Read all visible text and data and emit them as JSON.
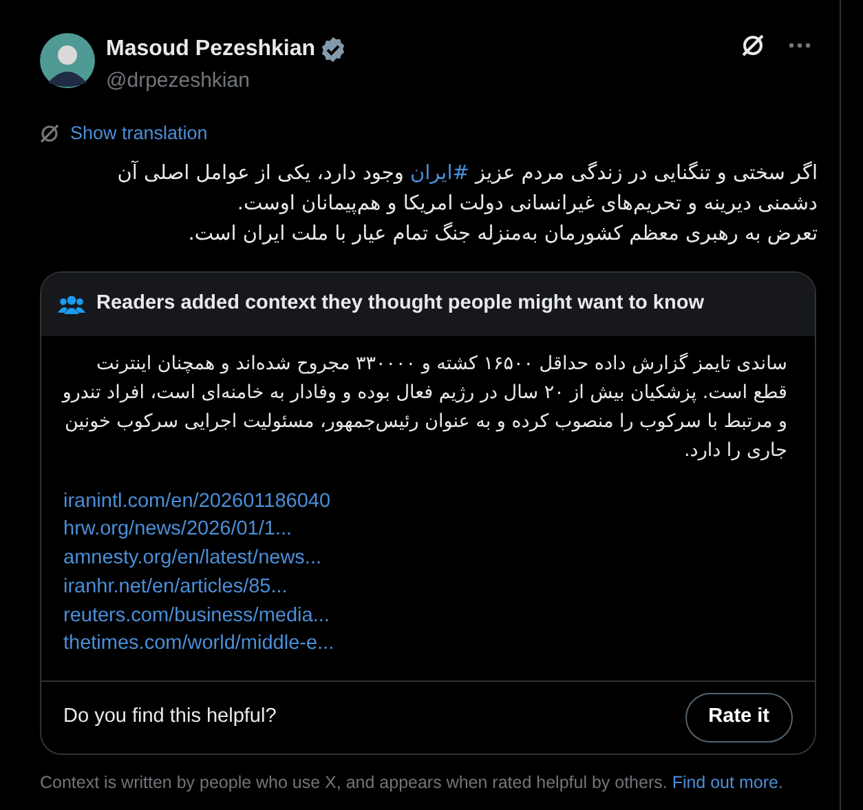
{
  "author": {
    "name": "Masoud Pezeshkian",
    "handle": "@drpezeshkian",
    "verified": true
  },
  "translate_link": "Show translation",
  "tweet": {
    "paragraphs": [
      [
        {
          "kind": "plain",
          "text": "اگر سختی و تنگنایی در زندگی مردم عزیز "
        },
        {
          "kind": "hashtag",
          "text": "#ایران"
        },
        {
          "kind": "plain",
          "text": " وجود دارد، یکی از عوامل اصلی آن دشمنی دیرینه و تحریم‌های غیرانسانی دولت امریکا و هم‌پیمانان اوست."
        }
      ],
      [
        {
          "kind": "plain",
          "text": "تعرض به رهبری معظم کشورمان به‌منزله جنگ تمام عیار با ملت ایران است."
        }
      ]
    ]
  },
  "community_note": {
    "header": "Readers added context they thought people might want to know",
    "body": "ساندی تایمز گزارش داده حداقل ۱۶۵۰۰ کشته و ۳۳۰۰۰۰ مجروح شده‌اند و همچنان اینترنت قطع است. پزشکیان بیش از ۲۰ سال در رژیم فعال بوده و وفادار به خامنه‌ای است، افراد تندرو و مرتبط با سرکوب را منصوب کرده و به عنوان رئیس‌جمهور، مسئولیت اجرایی سرکوب خونین جاری را دارد.",
    "links": [
      "iranintl.com/en/202601186040",
      "hrw.org/news/2026/01/1...",
      "amnesty.org/en/latest/news...",
      "iranhr.net/en/articles/85...",
      "reuters.com/business/media...",
      "thetimes.com/world/middle-e..."
    ],
    "question": "Do you find this helpful?",
    "rate_button": "Rate it"
  },
  "footnote": {
    "text": "Context is written by people who use X, and appears when rated helpful by others.",
    "link": "Find out more",
    "end": "."
  }
}
